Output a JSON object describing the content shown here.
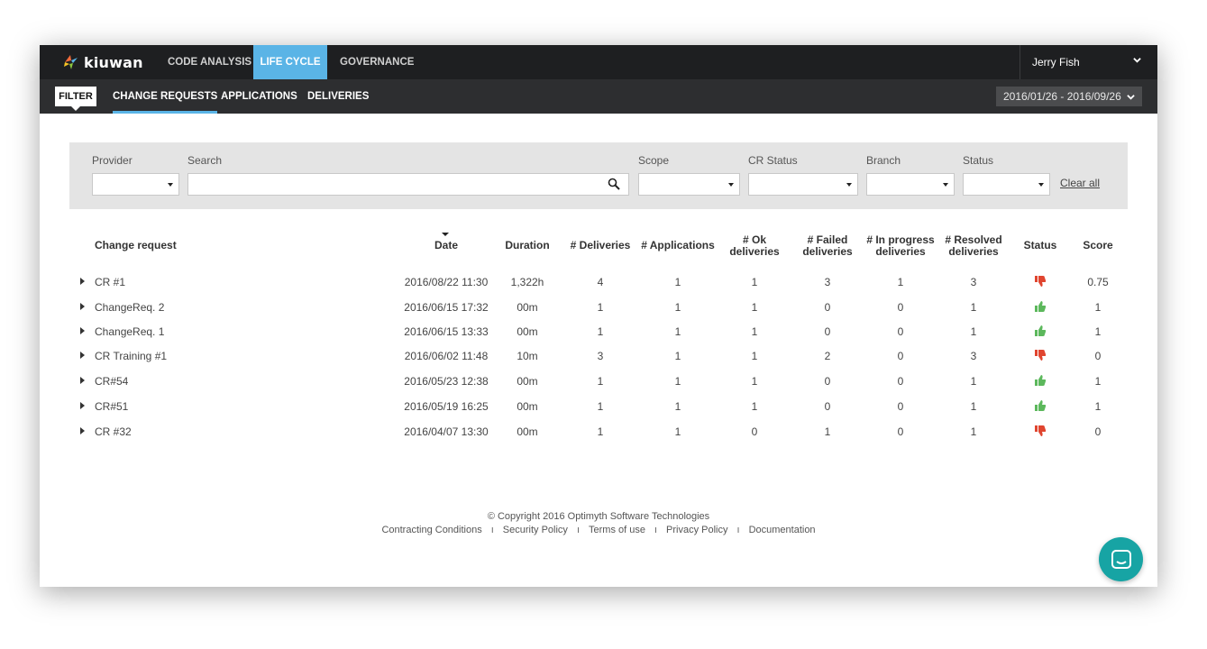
{
  "topbar": {
    "logo_text": "kiuwan",
    "tabs": [
      {
        "label": "CODE ANALYSIS",
        "active": false
      },
      {
        "label": "LIFE CYCLE",
        "active": true
      },
      {
        "label": "GOVERNANCE",
        "active": false
      }
    ],
    "user_name": "Jerry Fish",
    "accent_color": "#5ab4e6"
  },
  "subbar": {
    "filter_label": "FILTER",
    "tabs": [
      {
        "label": "CHANGE REQUESTS",
        "active": true
      },
      {
        "label": "APPLICATIONS",
        "active": false
      },
      {
        "label": "DELIVERIES",
        "active": false
      }
    ],
    "date_range": "2016/01/26 - 2016/09/26"
  },
  "filters": {
    "provider_label": "Provider",
    "search_label": "Search",
    "search_value": "",
    "scope_label": "Scope",
    "cr_status_label": "CR Status",
    "branch_label": "Branch",
    "status_label": "Status",
    "clear_all": "Clear all"
  },
  "table": {
    "headers": {
      "change_request": "Change request",
      "date": "Date",
      "duration": "Duration",
      "deliveries": "# Deliveries",
      "applications": "# Applications",
      "ok_line1": "# Ok",
      "ok_line2": "deliveries",
      "failed_line1": "# Failed",
      "failed_line2": "deliveries",
      "inprogress_line1": "# In progress",
      "inprogress_line2": "deliveries",
      "resolved_line1": "# Resolved",
      "resolved_line2": "deliveries",
      "status": "Status",
      "score": "Score"
    },
    "rows": [
      {
        "name": "CR #1",
        "date": "2016/08/22 11:30",
        "duration": "1,322h",
        "deliveries": "4",
        "applications": "1",
        "ok": "1",
        "failed": "3",
        "in_progress": "1",
        "resolved": "3",
        "status": "thumbs-down",
        "score": "0.75"
      },
      {
        "name": "ChangeReq. 2",
        "date": "2016/06/15 17:32",
        "duration": "00m",
        "deliveries": "1",
        "applications": "1",
        "ok": "1",
        "failed": "0",
        "in_progress": "0",
        "resolved": "1",
        "status": "thumbs-up",
        "score": "1"
      },
      {
        "name": "ChangeReq. 1",
        "date": "2016/06/15 13:33",
        "duration": "00m",
        "deliveries": "1",
        "applications": "1",
        "ok": "1",
        "failed": "0",
        "in_progress": "0",
        "resolved": "1",
        "status": "thumbs-up",
        "score": "1"
      },
      {
        "name": "CR Training #1",
        "date": "2016/06/02 11:48",
        "duration": "10m",
        "deliveries": "3",
        "applications": "1",
        "ok": "1",
        "failed": "2",
        "in_progress": "0",
        "resolved": "3",
        "status": "thumbs-down",
        "score": "0"
      },
      {
        "name": "CR#54",
        "date": "2016/05/23 12:38",
        "duration": "00m",
        "deliveries": "1",
        "applications": "1",
        "ok": "1",
        "failed": "0",
        "in_progress": "0",
        "resolved": "1",
        "status": "thumbs-up",
        "score": "1"
      },
      {
        "name": "CR#51",
        "date": "2016/05/19 16:25",
        "duration": "00m",
        "deliveries": "1",
        "applications": "1",
        "ok": "1",
        "failed": "0",
        "in_progress": "0",
        "resolved": "1",
        "status": "thumbs-up",
        "score": "1"
      },
      {
        "name": "CR #32",
        "date": "2016/04/07 13:30",
        "duration": "00m",
        "deliveries": "1",
        "applications": "1",
        "ok": "0",
        "failed": "1",
        "in_progress": "0",
        "resolved": "1",
        "status": "thumbs-down",
        "score": "0"
      }
    ],
    "status_colors": {
      "thumbs-up": "#5cb85c",
      "thumbs-down": "#e0452f"
    }
  },
  "footer": {
    "copyright": "© Copyright 2016 Optimyth Software Technologies",
    "links": [
      "Contracting Conditions",
      "Security Policy",
      "Terms of use",
      "Privacy Policy",
      "Documentation"
    ]
  }
}
